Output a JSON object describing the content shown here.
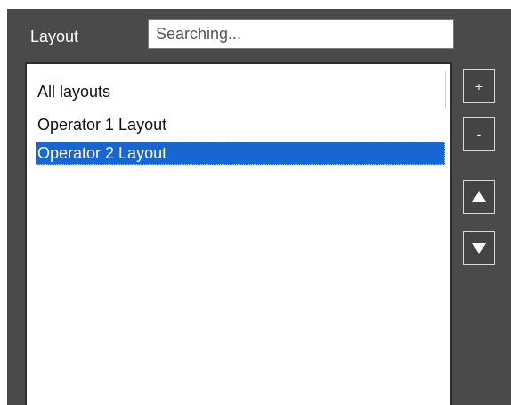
{
  "layout_label": "Layout",
  "search": {
    "value": "",
    "placeholder": "Searching..."
  },
  "list": {
    "items": [
      {
        "label": "All layouts",
        "selected": false
      },
      {
        "label": "Operator 1 Layout",
        "selected": false
      },
      {
        "label": "Operator 2 Layout",
        "selected": true
      }
    ]
  },
  "buttons": {
    "add": "+",
    "remove": "-",
    "up_icon": "triangle-up-icon",
    "down_icon": "triangle-down-icon"
  },
  "colors": {
    "panel_background": "#4a4a4a",
    "selection": "#1766d1",
    "list_background": "#ffffff"
  }
}
